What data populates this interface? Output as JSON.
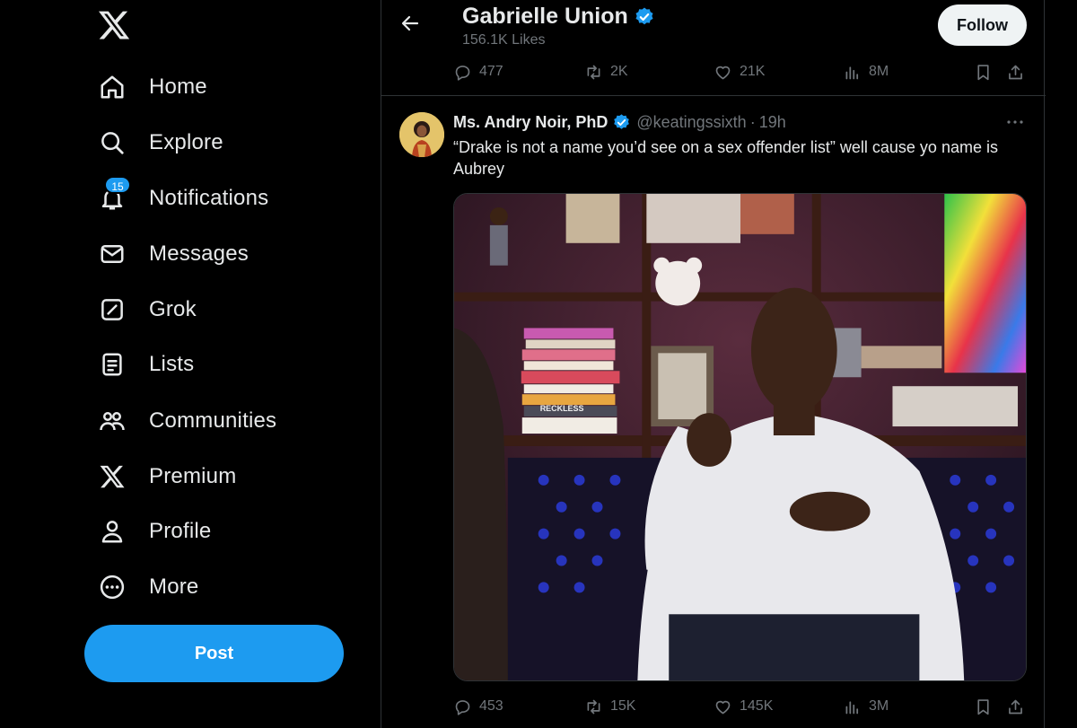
{
  "app": {
    "logo_icon": "x-logo-icon"
  },
  "sidebar": {
    "items": [
      {
        "label": "Home",
        "icon": "home-icon"
      },
      {
        "label": "Explore",
        "icon": "search-icon"
      },
      {
        "label": "Notifications",
        "icon": "bell-icon",
        "badge": "15"
      },
      {
        "label": "Messages",
        "icon": "envelope-icon"
      },
      {
        "label": "Grok",
        "icon": "grok-icon"
      },
      {
        "label": "Lists",
        "icon": "list-icon"
      },
      {
        "label": "Communities",
        "icon": "people-icon"
      },
      {
        "label": "Premium",
        "icon": "x-logo-icon"
      },
      {
        "label": "Profile",
        "icon": "person-icon"
      },
      {
        "label": "More",
        "icon": "more-circle-icon"
      }
    ],
    "post_label": "Post"
  },
  "header": {
    "name": "Gabrielle Union",
    "likes": "156.1K Likes",
    "follow_label": "Follow",
    "back_icon": "arrow-left-icon"
  },
  "top_actions": {
    "replies": "477",
    "reposts": "2K",
    "likes": "21K",
    "views": "8M"
  },
  "tweet": {
    "author_name": "Ms. Andry Noir, PhD",
    "handle": "@keatingssixth",
    "dot": "·",
    "time": "19h",
    "text": "“Drake is not a name you’d see on a sex offender list” well cause yo name is Aubrey",
    "media_book_label": "RECKLESS",
    "actions": {
      "replies": "453",
      "reposts": "15K",
      "likes": "145K",
      "views": "3M"
    }
  },
  "colors": {
    "background": "#000000",
    "accent": "#1d9bf0",
    "text_primary": "#e7e9ea",
    "text_secondary": "#71767b",
    "border": "#2f3336"
  }
}
